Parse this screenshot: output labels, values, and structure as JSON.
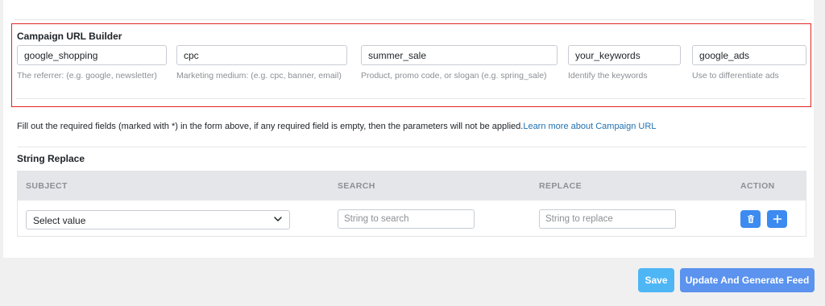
{
  "campaign_builder": {
    "title": "Campaign URL Builder",
    "fields": [
      {
        "value": "google_shopping",
        "help": "The referrer: (e.g. google, newsletter)"
      },
      {
        "value": "cpc",
        "help": "Marketing medium: (e.g. cpc, banner, email)"
      },
      {
        "value": "summer_sale",
        "help": "Product, promo code, or slogan (e.g. spring_sale)"
      },
      {
        "value": "your_keywords",
        "help": "Identify the keywords"
      },
      {
        "value": "google_ads",
        "help": "Use to differentiate ads"
      }
    ]
  },
  "notice": {
    "text": "Fill out the required fields (marked with *) in the form above, if any required field is empty, then the parameters will not be applied.",
    "link": "Learn more about Campaign URL"
  },
  "string_replace": {
    "title": "String Replace",
    "columns": {
      "subject": "SUBJECT",
      "search": "SEARCH",
      "replace": "REPLACE",
      "action": "ACTION"
    },
    "row": {
      "subject_value": "Select value",
      "search_placeholder": "String to search",
      "replace_placeholder": "String to replace"
    }
  },
  "footer": {
    "save_label": "Save",
    "update_label": "Update And Generate Feed"
  },
  "icons": {
    "delete": "trash-icon",
    "add": "plus-icon",
    "dropdown": "chevron-down-icon"
  },
  "colors": {
    "highlight_border": "#e02424",
    "primary": "#3d8bf0",
    "save": "#4fb6f6",
    "link": "#2271b1"
  }
}
